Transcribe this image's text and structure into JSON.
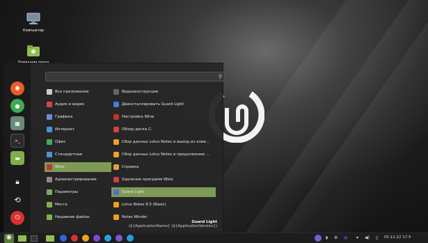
{
  "desktop": {
    "icons": [
      {
        "label": "Компьютер"
      },
      {
        "label": "Домашняя папка"
      }
    ]
  },
  "menu": {
    "search": {
      "value": "",
      "placeholder": ""
    },
    "categories": [
      {
        "label": "Все приложения",
        "icon": "grid-icon",
        "color": "#cccccc"
      },
      {
        "label": "Аудио и видео",
        "icon": "media-icon",
        "color": "#d94444"
      },
      {
        "label": "Графика",
        "icon": "graphics-icon",
        "color": "#6a8cd9"
      },
      {
        "label": "Интернет",
        "icon": "internet-icon",
        "color": "#4a90d9"
      },
      {
        "label": "Офис",
        "icon": "office-icon",
        "color": "#3faa55"
      },
      {
        "label": "Стандартные",
        "icon": "accessories-icon",
        "color": "#5a8fd0"
      },
      {
        "label": "Wine",
        "icon": "wine-icon",
        "color": "#b83a3a"
      },
      {
        "label": "Администрирование",
        "icon": "admin-icon",
        "color": "#8a8a8a"
      },
      {
        "label": "Параметры",
        "icon": "settings-icon",
        "color": "#7aaa6a"
      },
      {
        "label": "Места",
        "icon": "places-icon",
        "color": "#7fb04a"
      },
      {
        "label": "Недавние файлы",
        "icon": "recent-icon",
        "color": "#7fb04a"
      }
    ],
    "apps": [
      {
        "label": "Видеоинструкции",
        "icon": "video-icon",
        "color": "#666666"
      },
      {
        "label": "Деинсталлировать Guard Light",
        "icon": "uninstall-icon",
        "color": "#4a7ad9"
      },
      {
        "label": "Настройка Wine",
        "icon": "wine-config-icon",
        "color": "#c83030"
      },
      {
        "label": "Обзор диска C:",
        "icon": "drive-icon",
        "color": "#d94040"
      },
      {
        "label": "Сбор данных Lotus Notes и выход из клие...",
        "icon": "lotus-icon",
        "color": "#f0a020"
      },
      {
        "label": "Сбор данных Lotus Notes и продолжение ...",
        "icon": "lotus-icon",
        "color": "#f0a020"
      },
      {
        "label": "Справка",
        "icon": "help-icon",
        "color": "#e0a040"
      },
      {
        "label": "Удаление программ Wine",
        "icon": "wine-remove-icon",
        "color": "#d04040"
      },
      {
        "label": "Guard Light",
        "icon": "guard-light-icon",
        "color": "#5a6ad0"
      },
      {
        "label": "Lotus Notes 8.5 (Basic)",
        "icon": "lotus-icon",
        "color": "#f0a020"
      },
      {
        "label": "Notes Minder",
        "icon": "notes-minder-icon",
        "color": "#f0a020"
      }
    ],
    "info": {
      "title": "Guard Light",
      "description": "(${ApplicationName} (${ApplicationVersion})"
    }
  },
  "taskbar": {
    "clock": "05.12.22 17:5"
  }
}
